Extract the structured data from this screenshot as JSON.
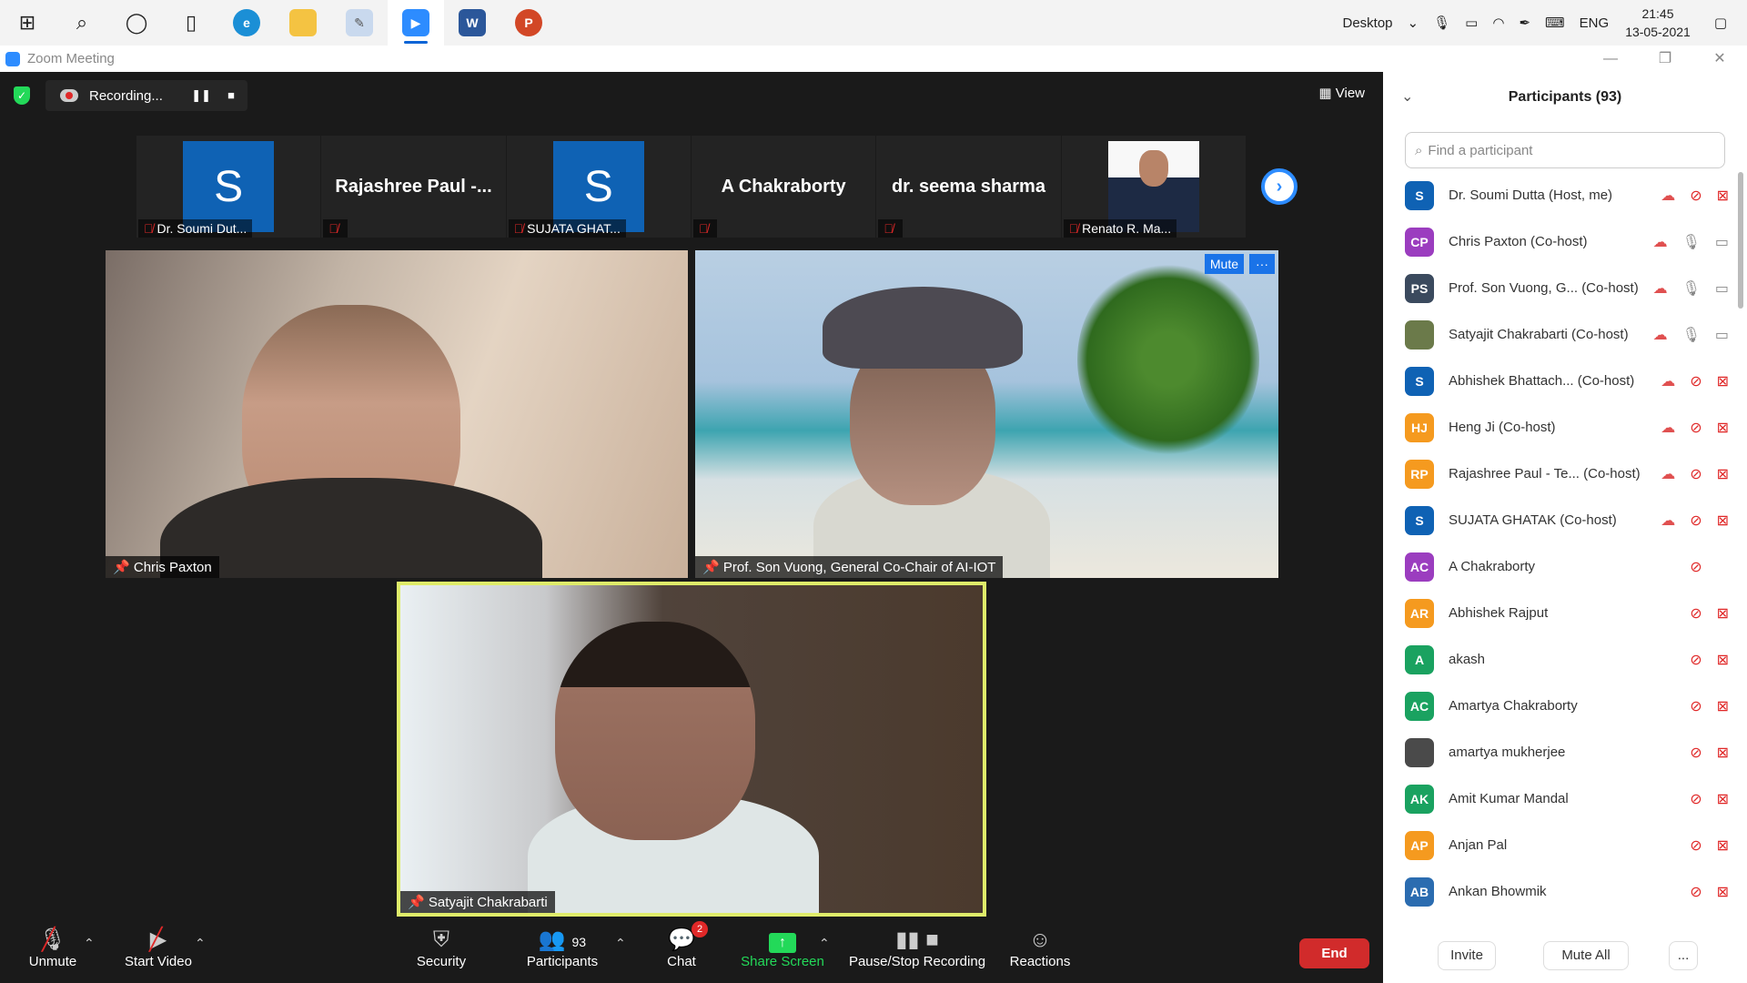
{
  "taskbar": {
    "desktop_label": "Desktop",
    "language": "ENG",
    "time": "21:45",
    "date": "13-05-2021"
  },
  "window": {
    "title": "Zoom Meeting"
  },
  "recording": {
    "label": "Recording..."
  },
  "view_label": "View",
  "thumbnails": [
    {
      "label": "Dr. Soumi Dut...",
      "display": "S"
    },
    {
      "label": "",
      "display": "Rajashree  Paul  -..."
    },
    {
      "label": "SUJATA GHAT...",
      "display": "S"
    },
    {
      "label": "",
      "display": "A Chakraborty"
    },
    {
      "label": "",
      "display": "dr. seema sharma"
    },
    {
      "label": "Renato R. Ma...",
      "display": ""
    }
  ],
  "videos": {
    "tile1_name": "Chris Paxton",
    "tile2_name": "Prof. Son Vuong, General Co-Chair of AI-IOT",
    "tile2_mute": "Mute",
    "tile2_more": "···",
    "tile3_name": "Satyajit Chakrabarti"
  },
  "toolbar": {
    "unmute": "Unmute",
    "start_video": "Start Video",
    "security": "Security",
    "participants": "Participants",
    "participants_count": "93",
    "chat": "Chat",
    "chat_badge": "2",
    "share_screen": "Share Screen",
    "pause_recording": "Pause/Stop Recording",
    "reactions": "Reactions",
    "end": "End"
  },
  "panel": {
    "title": "Participants (93)",
    "search_placeholder": "Find a participant",
    "participants": [
      {
        "initials": "S",
        "name": "Dr. Soumi Dutta (Host, me)",
        "color": "#0f62b4",
        "rec": true,
        "mic": "muted",
        "video": "off"
      },
      {
        "initials": "CP",
        "name": "Chris Paxton (Co-host)",
        "color": "#9b3dbf",
        "rec": true,
        "mic": "on",
        "video": "on"
      },
      {
        "initials": "PS",
        "name": "Prof. Son Vuong, G...  (Co-host)",
        "color": "#3b4a5e",
        "rec": true,
        "mic": "on",
        "video": "on"
      },
      {
        "initials": "",
        "name": "Satyajit Chakrabarti (Co-host)",
        "color": "#6b7a4a",
        "rec": true,
        "mic": "on",
        "video": "on"
      },
      {
        "initials": "S",
        "name": "Abhishek Bhattach...  (Co-host)",
        "color": "#0f62b4",
        "rec": true,
        "mic": "muted",
        "video": "off"
      },
      {
        "initials": "HJ",
        "name": "Heng Ji (Co-host)",
        "color": "#f59a1f",
        "rec": true,
        "mic": "muted",
        "video": "off"
      },
      {
        "initials": "RP",
        "name": "Rajashree Paul - Te...  (Co-host)",
        "color": "#f59a1f",
        "rec": true,
        "mic": "muted",
        "video": "off"
      },
      {
        "initials": "S",
        "name": "SUJATA GHATAK (Co-host)",
        "color": "#0f62b4",
        "rec": true,
        "mic": "muted",
        "video": "off"
      },
      {
        "initials": "AC",
        "name": "A Chakraborty",
        "color": "#9b3dbf",
        "rec": false,
        "mic": "muted",
        "video": "none"
      },
      {
        "initials": "AR",
        "name": "Abhishek Rajput",
        "color": "#f59a1f",
        "rec": false,
        "mic": "muted",
        "video": "off"
      },
      {
        "initials": "A",
        "name": "akash",
        "color": "#1aa260",
        "rec": false,
        "mic": "muted",
        "video": "off"
      },
      {
        "initials": "AC",
        "name": "Amartya Chakraborty",
        "color": "#1aa260",
        "rec": false,
        "mic": "muted",
        "video": "off"
      },
      {
        "initials": "",
        "name": "amartya mukherjee",
        "color": "#4a4a4a",
        "rec": false,
        "mic": "muted",
        "video": "off"
      },
      {
        "initials": "AK",
        "name": "Amit Kumar Mandal",
        "color": "#1aa260",
        "rec": false,
        "mic": "muted",
        "video": "off"
      },
      {
        "initials": "AP",
        "name": "Anjan Pal",
        "color": "#f59a1f",
        "rec": false,
        "mic": "muted",
        "video": "off"
      },
      {
        "initials": "AB",
        "name": "Ankan Bhowmik",
        "color": "#2b6cb0",
        "rec": false,
        "mic": "muted",
        "video": "off"
      }
    ],
    "invite": "Invite",
    "mute_all": "Mute All",
    "more": "..."
  }
}
